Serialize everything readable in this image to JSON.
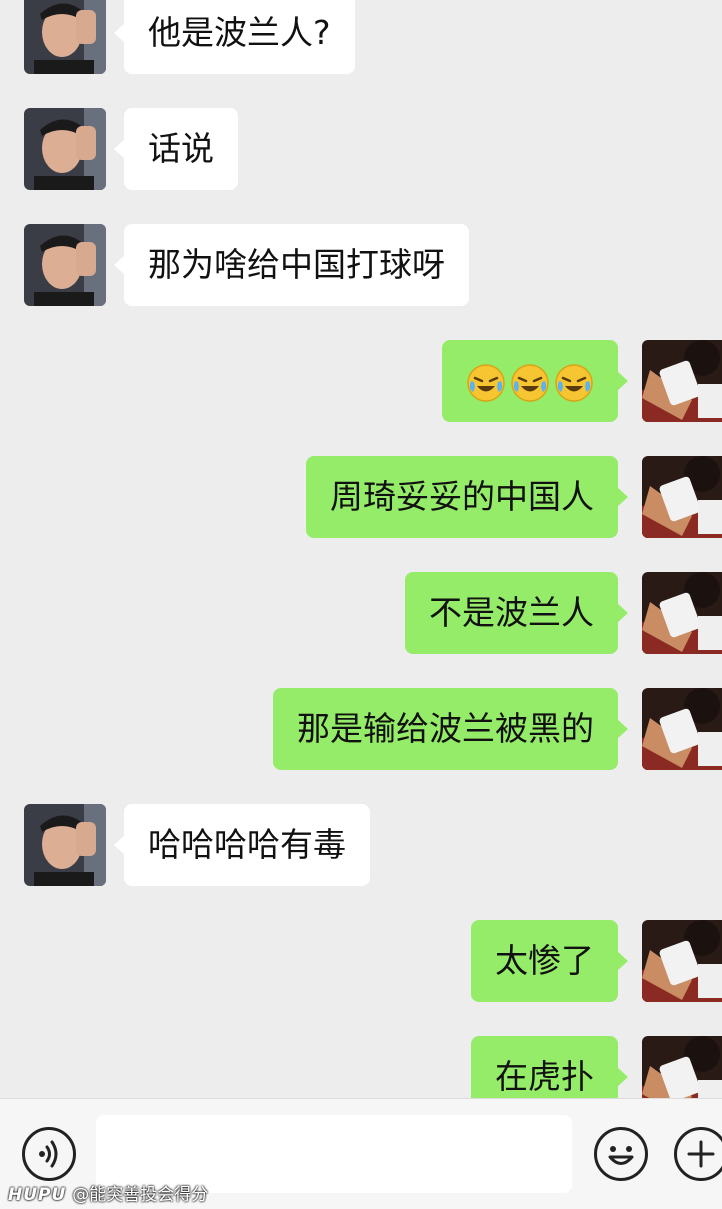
{
  "chat": {
    "messages": [
      {
        "side": "left",
        "text": "他是波兰人?"
      },
      {
        "side": "left",
        "text": "话说"
      },
      {
        "side": "left",
        "text": "那为啥给中国打球呀"
      },
      {
        "side": "right",
        "emojis": [
          "crying-laughing-face-icon",
          "crying-laughing-face-icon",
          "crying-laughing-face-icon"
        ]
      },
      {
        "side": "right",
        "text": "周琦妥妥的中国人"
      },
      {
        "side": "right",
        "text": "不是波兰人"
      },
      {
        "side": "right",
        "text": "那是输给波兰被黑的"
      },
      {
        "side": "left",
        "text": "哈哈哈哈有毒"
      },
      {
        "side": "right",
        "text": "太惨了"
      },
      {
        "side": "right",
        "text": "在虎扑"
      }
    ]
  },
  "colors": {
    "background": "#ededed",
    "outgoing_bubble": "#95ec69",
    "incoming_bubble": "#ffffff"
  },
  "input_bar": {
    "voice_icon": "voice-wave-icon",
    "text_value": "",
    "emoji_icon": "smiley-icon",
    "more_icon": "plus-icon"
  },
  "watermark": {
    "brand": "HUPU",
    "text": "@能突善投会得分"
  }
}
